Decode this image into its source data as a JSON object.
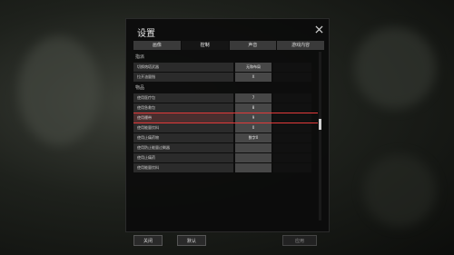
{
  "dialog": {
    "title": "设置"
  },
  "tabs": [
    {
      "label": "画像"
    },
    {
      "label": "控制"
    },
    {
      "label": "声音"
    },
    {
      "label": "游戏内容"
    }
  ],
  "sections": [
    {
      "heading": "指派",
      "rows": [
        {
          "label": "切换炮塔武器",
          "key1": "无和布局",
          "key2": ""
        },
        {
          "label": "拉开油量指",
          "key1": "X",
          "key2": ""
        }
      ]
    },
    {
      "heading": "物品",
      "rows": [
        {
          "label": "使用医疗包",
          "key1": "7",
          "key2": ""
        },
        {
          "label": "使用急救包",
          "key1": "8",
          "key2": ""
        },
        {
          "label": "使用绷带",
          "key1": "9",
          "key2": "",
          "highlight": true
        },
        {
          "label": "使用能量饮料",
          "key1": "0",
          "key2": ""
        },
        {
          "label": "使用止痛药物",
          "key1": "数字0",
          "key2": ""
        },
        {
          "label": "使用防止能量过剩器",
          "key1": "",
          "key2": ""
        },
        {
          "label": "使用止痛药",
          "key1": "",
          "key2": ""
        },
        {
          "label": "使用能量饮料",
          "key1": "",
          "key2": ""
        }
      ]
    }
  ],
  "footer": {
    "close_label": "关闭",
    "default_label": "默认",
    "apply_label": "应用"
  },
  "colors": {
    "highlight": "#e33a3a",
    "active_tab": "#151515",
    "tab": "#3a3a3a"
  }
}
